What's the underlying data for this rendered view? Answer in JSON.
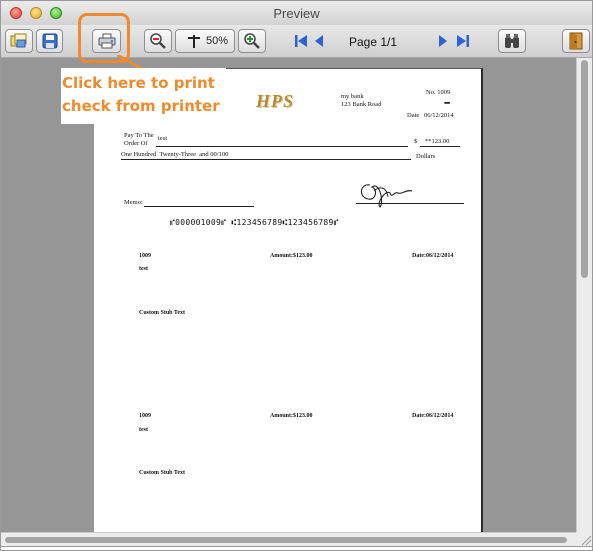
{
  "window": {
    "title": "Preview"
  },
  "toolbar": {
    "zoom_level": "50%",
    "page_indicator": "Page 1/1"
  },
  "annotation": {
    "line1": "Click here to print",
    "line2": "check from printer"
  },
  "check": {
    "logo": "HPS",
    "bank_name": "my bank",
    "bank_address": "123 Bank Road",
    "check_no": "No. 1009",
    "date_label": "Date",
    "date_value": "06/12/2014",
    "pay_to_line1": "Pay To The",
    "pay_to_line2": "Order Of",
    "payee": "test",
    "dollar_sign": "$",
    "amount": "**123.00",
    "amount_words": "One Hundred  Twenty-Three  and 00/100",
    "dollars_label": "Dollars",
    "memo_label": "Memo:",
    "micr_line": "⑈000001009⑈ ⑆123456789⑆123456789⑈"
  },
  "stubs": [
    {
      "number": "1009",
      "amount": "Amount:$123.00",
      "date": "Date:06/12/2014",
      "payee": "test",
      "text": "Custom Stub Text"
    },
    {
      "number": "1009",
      "amount": "Amount:$123.00",
      "date": "Date:06/12/2014",
      "payee": "test",
      "text": "Custom Stub Text"
    }
  ],
  "colors": {
    "annotation": "#f08a2c",
    "nav_arrows": "#2b63d6"
  }
}
